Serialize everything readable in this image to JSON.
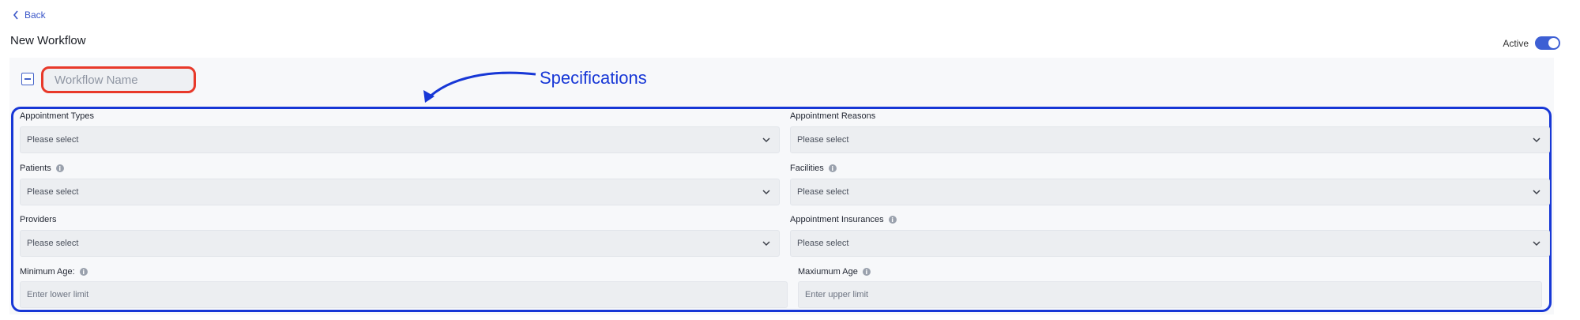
{
  "nav": {
    "back_label": "Back"
  },
  "page": {
    "title": "New Workflow"
  },
  "status": {
    "active_label": "Active",
    "active": true
  },
  "workflow": {
    "name_placeholder": "Workflow Name"
  },
  "annotation": {
    "label": "Specifications"
  },
  "fields": {
    "appointment_types": {
      "label": "Appointment Types",
      "value": "Please select"
    },
    "appointment_reasons": {
      "label": "Appointment Reasons",
      "value": "Please select"
    },
    "patients": {
      "label": "Patients",
      "value": "Please select"
    },
    "facilities": {
      "label": "Facilities",
      "value": "Please select"
    },
    "providers": {
      "label": "Providers",
      "value": "Please select"
    },
    "appointment_insurances": {
      "label": "Appointment Insurances",
      "value": "Please select"
    },
    "minimum_age": {
      "label": "Minimum Age:",
      "placeholder": "Enter lower limit"
    },
    "maximum_age": {
      "label": "Maxiumum Age",
      "placeholder": "Enter upper limit"
    }
  },
  "icons": {
    "back": "chevron-left-icon",
    "collapse": "minus-square-icon",
    "info": "info-icon",
    "dropdown": "chevron-down-icon"
  },
  "colors": {
    "accent": "#3d5fd4",
    "annotation_blue": "#1737d6",
    "annotation_red": "#e8392a"
  }
}
